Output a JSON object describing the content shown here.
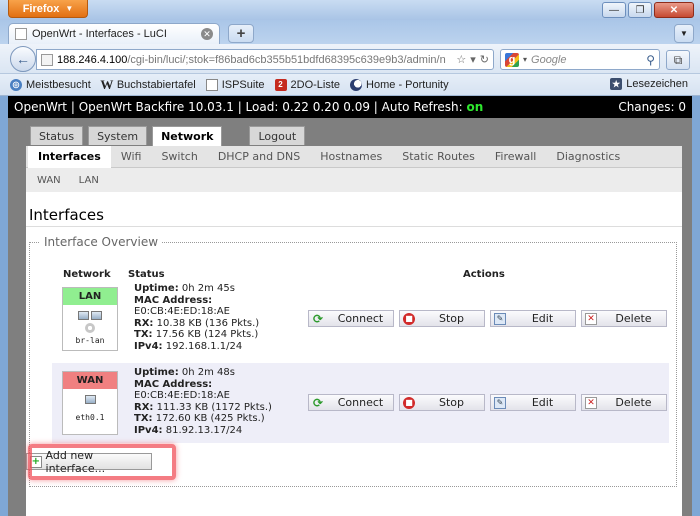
{
  "browser": {
    "menu_button": "Firefox",
    "tab_title": "OpenWrt - Interfaces - LuCI",
    "url_host": "188.246.4.100",
    "url_path": "/cgi-bin/luci/;stok=f86bad6cb355b51bdfd68395c639e9b3/admin/n",
    "search_placeholder": "Google",
    "bookmarks": [
      {
        "label": "Meistbesucht",
        "icon": "globe-icon"
      },
      {
        "label": "Buchstabiertafel",
        "icon": "wikipedia-icon"
      },
      {
        "label": "ISPSuite",
        "icon": "page-icon"
      },
      {
        "label": "2DO-Liste",
        "icon": "todo-icon"
      },
      {
        "label": "Home - Portunity",
        "icon": "moon-icon"
      }
    ],
    "bookmarks_right": "Lesezeichen"
  },
  "luci": {
    "statusbar": {
      "prefix": "OpenWrt | OpenWrt Backfire 10.03.1 | Load: 0.22 0.20 0.09 | Auto Refresh: ",
      "auto_refresh": "on",
      "changes": "Changes: 0"
    },
    "main_tabs": [
      "Status",
      "System",
      "Network",
      "Logout"
    ],
    "main_tabs_active": "Network",
    "sub_tabs": [
      "Interfaces",
      "Wifi",
      "Switch",
      "DHCP and DNS",
      "Hostnames",
      "Static Routes",
      "Firewall",
      "Diagnostics"
    ],
    "sub_tabs_active": "Interfaces",
    "sub_sub_tabs": [
      "WAN",
      "LAN"
    ],
    "page_title": "Interfaces",
    "fieldset_legend": "Interface Overview",
    "table_headers": {
      "network": "Network",
      "status": "Status",
      "actions": "Actions"
    },
    "interfaces": [
      {
        "name": "LAN",
        "device": "br-lan",
        "uptime_label": "Uptime:",
        "uptime": "0h 2m 45s",
        "mac_label": "MAC Address:",
        "mac": "E0:CB:4E:ED:18:AE",
        "rx_label": "RX:",
        "rx": "10.38 KB (136 Pkts.)",
        "tx_label": "TX:",
        "tx": "17.56 KB (124 Pkts.)",
        "ipv4_label": "IPv4:",
        "ipv4": "192.168.1.1/24"
      },
      {
        "name": "WAN",
        "device": "eth0.1",
        "uptime_label": "Uptime:",
        "uptime": "0h 2m 48s",
        "mac_label": "MAC Address:",
        "mac": "E0:CB:4E:ED:18:AE",
        "rx_label": "RX:",
        "rx": "111.33 KB (1172 Pkts.)",
        "tx_label": "TX:",
        "tx": "172.60 KB (425 Pkts.)",
        "ipv4_label": "IPv4:",
        "ipv4": "81.92.13.17/24"
      }
    ],
    "action_buttons": {
      "connect": "Connect",
      "stop": "Stop",
      "edit": "Edit",
      "delete": "Delete"
    },
    "add_button": "Add new interface..."
  },
  "colors": {
    "lan_badge": "#90ee90",
    "wan_badge": "#f08080",
    "auto_refresh_on": "#2ee82e",
    "highlight": "#f0505a"
  }
}
